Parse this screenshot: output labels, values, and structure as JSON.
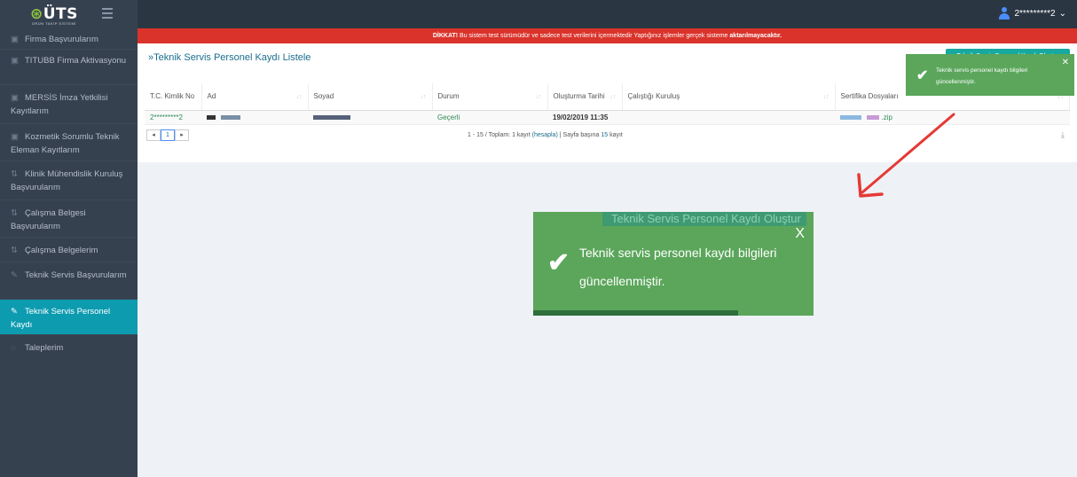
{
  "app": {
    "logo_text": "ÜTS",
    "logo_sub": "ÜRÜN TAKİP SİSTEMİ",
    "user_name": "2*********2"
  },
  "sidebar": {
    "items": [
      {
        "label": "Firma Başvurularım",
        "icon": "calendar-icon"
      },
      {
        "label": "TITUBB Firma Aktivasyonu",
        "icon": "calendar-icon"
      },
      {
        "label": "MERSİS İmza Yetkilisi Kayıtlarım",
        "icon": "calendar-icon"
      },
      {
        "label": "Kozmetik Sorumlu Teknik Eleman Kayıtlarım",
        "icon": "calendar-icon"
      },
      {
        "label": "Klinik Mühendislik Kuruluş Başvurularım",
        "icon": "flow-icon"
      },
      {
        "label": "Çalışma Belgesi Başvurularım",
        "icon": "flow-icon"
      },
      {
        "label": "Çalışma Belgelerim",
        "icon": "flow-icon"
      },
      {
        "label": "Teknik Servis Başvurularım",
        "icon": "pencil-icon"
      },
      {
        "label": "Teknik Servis Personel Kaydı",
        "icon": "pencil-icon",
        "active": true
      },
      {
        "label": "Taleplerim",
        "icon": "chat-icon"
      }
    ]
  },
  "warning": {
    "prefix": "DİKKAT!",
    "text": " Bu sistem test sürümüdür ve sadece test verilerini içermektedir Yaptığınız işlemler gerçek sisteme ",
    "suffix": "aktarılmayacaktır."
  },
  "page": {
    "title": "»Teknik Servis Personel Kaydı Listele",
    "hidden_button": "Teknik Servis Personel Kaydı Oluştur"
  },
  "table": {
    "columns": [
      "T.C. Kimlik No",
      "Ad",
      "Soyad",
      "Durum",
      "Oluşturma Tarihi",
      "Çalıştığı Kuruluş",
      "Sertifika Dosyaları"
    ],
    "rows": [
      {
        "tc": "2*********2",
        "ad": "",
        "soyad": "",
        "durum": "Geçerli",
        "tarih": "19/02/2019 11:35",
        "kurulus": "",
        "sertifika": ".zip"
      }
    ]
  },
  "pager": {
    "page": "1",
    "info_prefix": "1 - 15 / Toplam: 1 kayıt ",
    "info_link": "(hesapla)",
    "info_mid": " | Sayfa başına ",
    "per_page": "15",
    "info_suffix": " kayıt"
  },
  "toast_small": {
    "line1": "Teknik servis personel kaydı bilgileri",
    "line2": "güncellenmiştir."
  },
  "toast_big": {
    "ghost": "Teknik Servis Personel Kaydı Oluştur",
    "line1": "Teknik servis personel kaydı bilgileri",
    "line2": "güncellenmiştir.",
    "progress": 0.73
  },
  "colors": {
    "accent": "#0d9bb0",
    "danger": "#d9332b",
    "success": "#5ba65b"
  }
}
